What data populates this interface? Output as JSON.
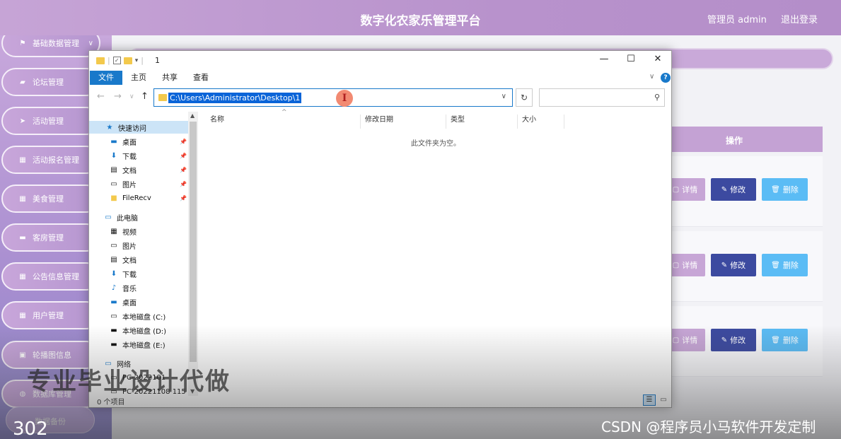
{
  "app": {
    "title": "数字化农家乐管理平台",
    "admin_label": "管理员 admin",
    "logout_label": "退出登录"
  },
  "sidebar": {
    "items": [
      {
        "label": "基础数据管理",
        "icon": "flag-icon"
      },
      {
        "label": "论坛管理",
        "icon": "chat-icon"
      },
      {
        "label": "活动管理",
        "icon": "send-icon"
      },
      {
        "label": "活动报名管理",
        "icon": "grid-icon"
      },
      {
        "label": "美食管理",
        "icon": "grid-icon"
      },
      {
        "label": "客房管理",
        "icon": "bed-icon"
      },
      {
        "label": "公告信息管理",
        "icon": "grid-icon"
      },
      {
        "label": "用户管理",
        "icon": "grid-icon"
      },
      {
        "label": "轮播图信息",
        "icon": "image-icon"
      },
      {
        "label": "数据库管理",
        "icon": "database-icon"
      }
    ],
    "backup_label": "数据备份"
  },
  "table": {
    "op_header": "操作",
    "rows": [
      {
        "detail": "详情",
        "edit": "修改",
        "delete": "删除"
      },
      {
        "detail": "详情",
        "edit": "修改",
        "delete": "删除"
      },
      {
        "detail": "详情",
        "edit": "修改",
        "delete": "删除"
      }
    ]
  },
  "explorer": {
    "title": "1",
    "ribbon_tabs": [
      "文件",
      "主页",
      "共享",
      "查看"
    ],
    "address": "C:\\Users\\Administrator\\Desktop\\1",
    "search_placeholder": "",
    "nav": [
      {
        "label": "快速访问",
        "icon": "star-icon",
        "pinned": false,
        "selected": true,
        "indent": 0
      },
      {
        "label": "桌面",
        "icon": "desktop-icon",
        "pinned": true,
        "indent": 1
      },
      {
        "label": "下载",
        "icon": "download-icon",
        "pinned": true,
        "indent": 1
      },
      {
        "label": "文档",
        "icon": "document-icon",
        "pinned": true,
        "indent": 1
      },
      {
        "label": "图片",
        "icon": "picture-icon",
        "pinned": true,
        "indent": 1
      },
      {
        "label": "FileRecv",
        "icon": "folder-icon",
        "pinned": true,
        "indent": 1
      },
      {
        "label": "此电脑",
        "icon": "computer-icon",
        "pinned": false,
        "indent": 0
      },
      {
        "label": "视频",
        "icon": "video-icon",
        "pinned": false,
        "indent": 1
      },
      {
        "label": "图片",
        "icon": "picture-icon",
        "pinned": false,
        "indent": 1
      },
      {
        "label": "文档",
        "icon": "document-icon",
        "pinned": false,
        "indent": 1
      },
      {
        "label": "下载",
        "icon": "download-icon",
        "pinned": false,
        "indent": 1
      },
      {
        "label": "音乐",
        "icon": "music-icon",
        "pinned": false,
        "indent": 1
      },
      {
        "label": "桌面",
        "icon": "desktop-icon",
        "pinned": false,
        "indent": 1
      },
      {
        "label": "本地磁盘 (C:)",
        "icon": "drive-c-icon",
        "pinned": false,
        "indent": 1
      },
      {
        "label": "本地磁盘 (D:)",
        "icon": "drive-icon",
        "pinned": false,
        "indent": 1
      },
      {
        "label": "本地磁盘 (E:)",
        "icon": "drive-icon",
        "pinned": false,
        "indent": 1
      },
      {
        "label": "网络",
        "icon": "network-icon",
        "pinned": false,
        "indent": 0
      },
      {
        "label": "PC-2022101",
        "icon": "computer-icon",
        "pinned": false,
        "indent": 1
      },
      {
        "label": "PC-20221108 115",
        "icon": "computer-icon",
        "pinned": false,
        "indent": 1
      }
    ],
    "columns": [
      "名称",
      "修改日期",
      "类型",
      "大小"
    ],
    "empty_message": "此文件夹为空。",
    "status": "0 个项目"
  },
  "overlay": {
    "watermark_text": "专业毕业设计代做",
    "video_number": "302",
    "csdn_text": "CSDN @程序员小马软件开发定制"
  },
  "colors": {
    "header_purple": "#b892cc",
    "edit_button": "#3c4aa0",
    "delete_button": "#5bbcf5",
    "explorer_accent": "#1979ca"
  }
}
